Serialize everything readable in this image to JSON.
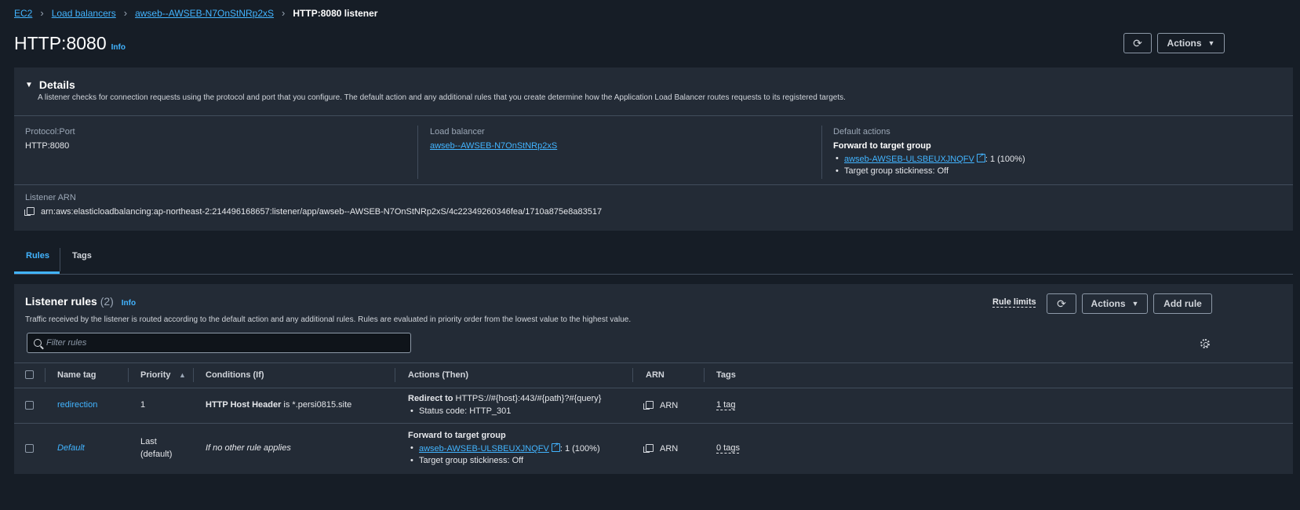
{
  "breadcrumb": {
    "items": [
      "EC2",
      "Load balancers",
      "awseb--AWSEB-N7OnStNRp2xS"
    ],
    "current": "HTTP:8080 listener"
  },
  "page": {
    "title": "HTTP:8080",
    "info": "Info"
  },
  "header_buttons": {
    "refresh_icon": "refresh-icon",
    "actions": "Actions"
  },
  "details": {
    "heading": "Details",
    "description": "A listener checks for connection requests using the protocol and port that you configure. The default action and any additional rules that you create determine how the Application Load Balancer routes requests to its registered targets.",
    "protocol_label": "Protocol:Port",
    "protocol_value": "HTTP:8080",
    "lb_label": "Load balancer",
    "lb_value": "awseb--AWSEB-N7OnStNRp2xS",
    "default_actions_label": "Default actions",
    "default_actions_title": "Forward to target group",
    "target_group_link": "awseb-AWSEB-ULSBEUXJNQFV",
    "target_group_weight": ": 1 (100%)",
    "stickiness": "Target group stickiness: Off",
    "arn_label": "Listener ARN",
    "arn_value": "arn:aws:elasticloadbalancing:ap-northeast-2:214496168657:listener/app/awseb--AWSEB-N7OnStNRp2xS/4c22349260346fea/1710a875e8a83517"
  },
  "tabs": [
    "Rules",
    "Tags"
  ],
  "rules": {
    "title": "Listener rules",
    "count": "(2)",
    "info": "Info",
    "description": "Traffic received by the listener is routed according to the default action and any additional rules. Rules are evaluated in priority order from the lowest value to the highest value.",
    "rule_limits": "Rule limits",
    "actions": "Actions",
    "add_rule": "Add rule",
    "filter_placeholder": "Filter rules",
    "columns": [
      "Name tag",
      "Priority",
      "Conditions (If)",
      "Actions (Then)",
      "ARN",
      "Tags"
    ],
    "rows": [
      {
        "name": "redirection",
        "priority": "1",
        "condition_bold": "HTTP Host Header",
        "condition_rest": " is *.persi0815.site",
        "action_bold": "Redirect to",
        "action_rest": " HTTPS://#{host}:443/#{path}?#{query}",
        "action_sub": "Status code: HTTP_301",
        "arn": "ARN",
        "tags": "1 tag"
      },
      {
        "name": "Default",
        "priority_line1": "Last",
        "priority_line2": "(default)",
        "condition": "If no other rule applies",
        "action_bold": "Forward to target group",
        "action_link": "awseb-AWSEB-ULSBEUXJNQFV",
        "action_weight": ": 1 (100%)",
        "action_sub": "Target group stickiness: Off",
        "arn": "ARN",
        "tags": "0 tags"
      }
    ]
  },
  "colors": {
    "link": "#42b4ff",
    "panel": "#232b36",
    "background": "#161d26"
  }
}
